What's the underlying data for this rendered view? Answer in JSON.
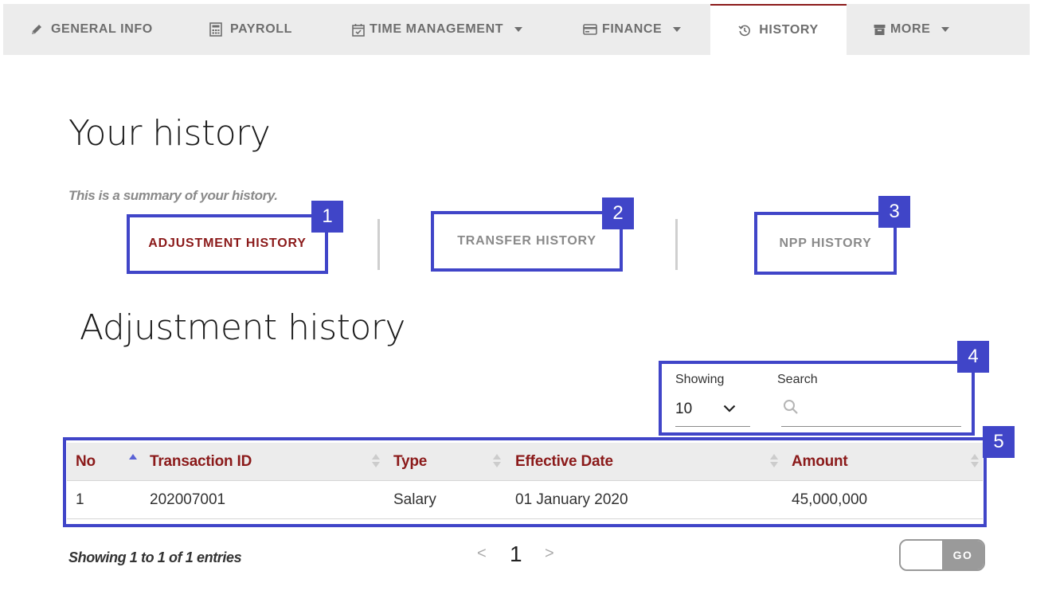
{
  "nav": {
    "tabs": [
      {
        "label": "GENERAL INFO",
        "icon": "pencil-icon",
        "dropdown": false
      },
      {
        "label": "PAYROLL",
        "icon": "calculator-icon",
        "dropdown": false
      },
      {
        "label": "TIME MANAGEMENT",
        "icon": "calendar-check-icon",
        "dropdown": true
      },
      {
        "label": "FINANCE",
        "icon": "credit-card-icon",
        "dropdown": true
      },
      {
        "label": "HISTORY",
        "icon": "history-icon",
        "dropdown": false,
        "active": true
      },
      {
        "label": "MORE",
        "icon": "archive-icon",
        "dropdown": true
      }
    ]
  },
  "page": {
    "title": "Your history",
    "summary": "This is a summary of your history."
  },
  "history_tabs": [
    {
      "label": "ADJUSTMENT HISTORY",
      "active": true
    },
    {
      "label": "TRANSFER HISTORY",
      "active": false
    },
    {
      "label": "NPP HISTORY",
      "active": false
    }
  ],
  "section": {
    "title": "Adjustment history"
  },
  "controls": {
    "showing_label": "Showing",
    "showing_value": "10",
    "search_label": "Search",
    "search_value": ""
  },
  "table": {
    "columns": [
      "No",
      "Transaction ID",
      "Type",
      "Effective Date",
      "Amount"
    ],
    "sorted_column": "No",
    "sort_direction": "ascending",
    "rows": [
      [
        "1",
        "202007001",
        "Salary",
        "01 January 2020",
        "45,000,000"
      ]
    ]
  },
  "footer": {
    "entries_text": "Showing 1 to 1 of 1 entries",
    "prev": "<",
    "current_page": "1",
    "next": ">",
    "go_label": "GO"
  },
  "annotations": [
    "1",
    "2",
    "3",
    "4",
    "5"
  ],
  "colors": {
    "accent": "#8b1a1a",
    "annotation": "#4045c8",
    "tabbar_bg": "#ececec",
    "muted_text": "#8a8a8a"
  }
}
